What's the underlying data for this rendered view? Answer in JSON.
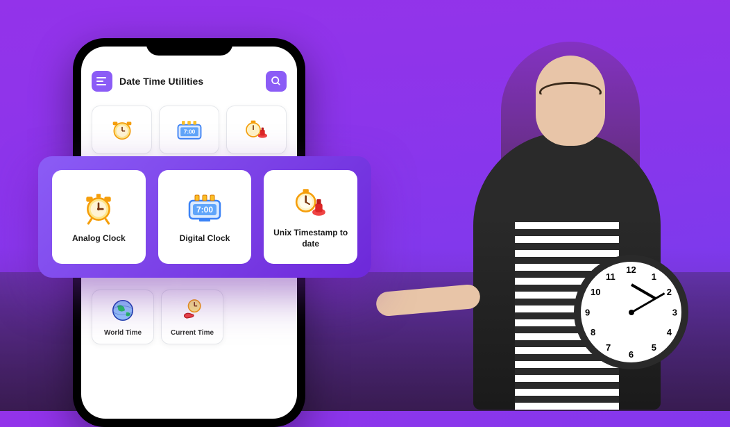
{
  "app": {
    "title": "Date Time Utilities"
  },
  "popout": {
    "items": [
      {
        "label": "Analog Clock",
        "icon": "analog-clock-icon"
      },
      {
        "label": "Digital Clock",
        "icon": "digital-clock-icon"
      },
      {
        "label": "Unix Timestamp to date",
        "icon": "stopwatch-stamp-icon"
      }
    ]
  },
  "bottom_tiles": [
    {
      "label": "World Time",
      "icon": "globe-icon"
    },
    {
      "label": "Current Time",
      "icon": "hand-clock-icon"
    }
  ],
  "digital_display": "7:00",
  "wall_clock": {
    "numbers": [
      "12",
      "1",
      "2",
      "3",
      "4",
      "5",
      "6",
      "7",
      "8",
      "9",
      "10",
      "11"
    ]
  }
}
